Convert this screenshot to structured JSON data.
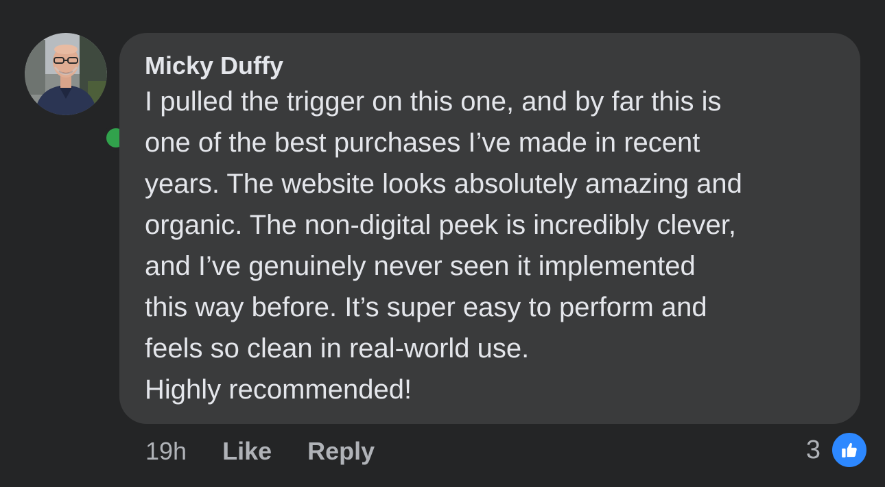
{
  "comment": {
    "author": "Micky Duffy",
    "text_lines": [
      "I pulled the trigger on this one, and by far this is",
      "one of the best purchases I’ve made in recent",
      "years. The website looks absolutely amazing and",
      "organic. The non-digital peek is incredibly clever,",
      "and I’ve genuinely never seen it implemented",
      "this way before. It’s super easy to perform and",
      "feels so clean in real-world use.",
      "Highly recommended!"
    ],
    "online": true
  },
  "actions": {
    "time": "19h",
    "like_label": "Like",
    "reply_label": "Reply"
  },
  "reactions": {
    "count": "3",
    "icon": "thumbs-up-icon"
  },
  "colors": {
    "background": "#242526",
    "bubble": "#3a3b3c",
    "online": "#31a24c",
    "like_blue": "#2d88ff"
  }
}
